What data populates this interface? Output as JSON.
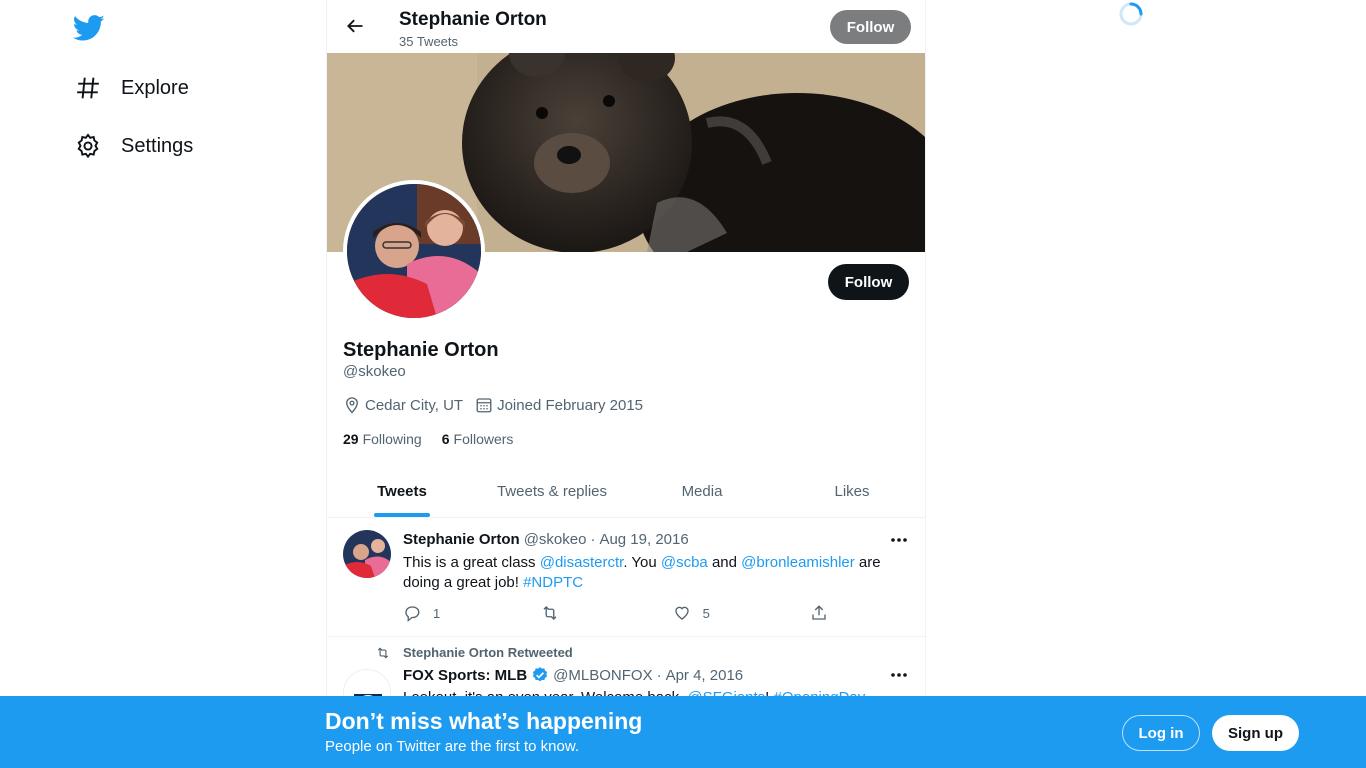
{
  "nav": {
    "logo_icon": "twitter-bird-icon",
    "items": [
      {
        "label": "Explore",
        "icon": "hashtag-icon"
      },
      {
        "label": "Settings",
        "icon": "gear-icon"
      }
    ]
  },
  "header": {
    "name": "Stephanie Orton",
    "tweet_count": "35 Tweets",
    "follow_label": "Follow"
  },
  "profile": {
    "name": "Stephanie Orton",
    "handle": "@skokeo",
    "location": "Cedar City, UT",
    "joined": "Joined February 2015",
    "following_count": "29",
    "following_label": "Following",
    "followers_count": "6",
    "followers_label": "Followers",
    "follow_label": "Follow"
  },
  "tabs": [
    {
      "label": "Tweets",
      "active": true
    },
    {
      "label": "Tweets & replies",
      "active": false
    },
    {
      "label": "Media",
      "active": false
    },
    {
      "label": "Likes",
      "active": false
    }
  ],
  "tweets": [
    {
      "author": "Stephanie Orton",
      "handle": "@skokeo",
      "sep": "·",
      "date": "Aug 19, 2016",
      "text_parts": [
        {
          "t": "This is a great class ",
          "link": false
        },
        {
          "t": "@disasterctr",
          "link": true
        },
        {
          "t": ". You ",
          "link": false
        },
        {
          "t": "@scba",
          "link": true
        },
        {
          "t": " and ",
          "link": false
        },
        {
          "t": "@bronleamishler",
          "link": true
        },
        {
          "t": " are doing a great job! ",
          "link": false
        },
        {
          "t": "#NDPTC",
          "link": true
        }
      ],
      "replies": "1",
      "retweets": "",
      "likes": "5"
    },
    {
      "retweeted_by": "Stephanie Orton Retweeted",
      "author": "FOX Sports: MLB",
      "verified": true,
      "handle": "@MLBONFOX",
      "sep": "·",
      "date": "Apr 4, 2016",
      "text_parts": [
        {
          "t": "Lookout, it's an even year. Welcome back, ",
          "link": false
        },
        {
          "t": "@SFGiants",
          "link": true
        },
        {
          "t": "! ",
          "link": false
        },
        {
          "t": "#OpeningDay",
          "link": true
        }
      ]
    }
  ],
  "bottom_banner": {
    "title": "Don’t miss what’s happening",
    "subtitle": "People on Twitter are the first to know.",
    "login_label": "Log in",
    "signup_label": "Sign up"
  },
  "colors": {
    "accent": "#1d9bf0",
    "text": "#0f1419",
    "muted": "#536471"
  }
}
